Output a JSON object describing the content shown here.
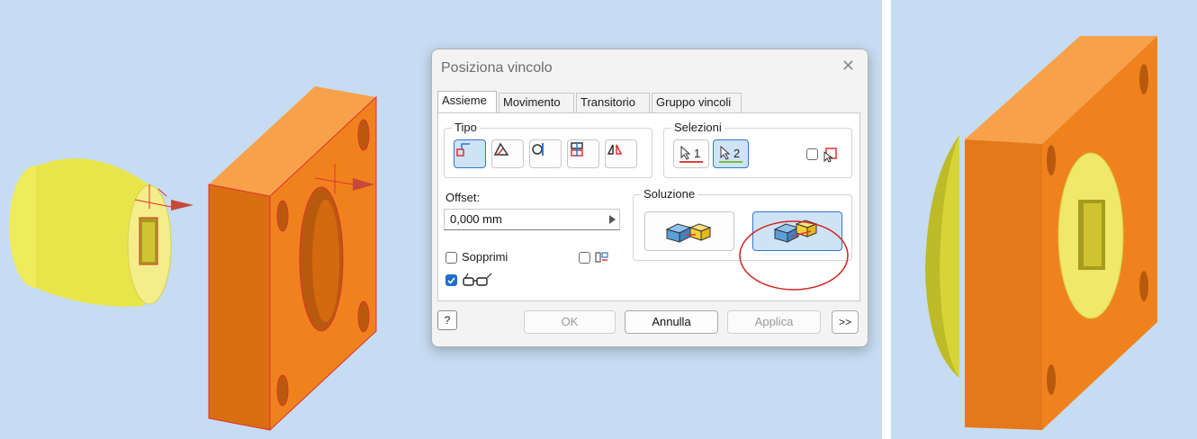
{
  "dialog": {
    "title": "Posiziona vincolo",
    "close_glyph": "✕",
    "tabs": [
      {
        "label": "Assieme",
        "active": true
      },
      {
        "label": "Movimento",
        "active": false
      },
      {
        "label": "Transitorio",
        "active": false
      },
      {
        "label": "Gruppo vincoli",
        "active": false
      }
    ],
    "tipo": {
      "label": "Tipo",
      "buttons": [
        {
          "icon": "mate-constraint-icon",
          "selected": true
        },
        {
          "icon": "angle-constraint-icon",
          "selected": false
        },
        {
          "icon": "tangent-constraint-icon",
          "selected": false
        },
        {
          "icon": "insert-constraint-icon",
          "selected": false
        },
        {
          "icon": "symmetry-constraint-icon",
          "selected": false
        }
      ]
    },
    "selezioni": {
      "label": "Selezioni",
      "buttons": [
        {
          "number": "1",
          "icon": "select-arrow-icon",
          "underline_color": "#e04040",
          "selected": false
        },
        {
          "number": "2",
          "icon": "select-arrow-icon",
          "underline_color": "#7bbd3a",
          "selected": true
        }
      ],
      "first_occurrence_checked": false,
      "first_occurrence_icon": "pick-part-first-icon"
    },
    "offset": {
      "label": "Offset:",
      "value": "0,000 mm"
    },
    "soluzione": {
      "label": "Soluzione",
      "options": [
        {
          "icon": "mate-solution-icon",
          "selected": false
        },
        {
          "icon": "flush-solution-icon",
          "selected": true
        }
      ]
    },
    "sopprimi": {
      "label": "Sopprimi",
      "checked": false
    },
    "predict_offset": {
      "checked": false,
      "icon": "predict-offset-icon"
    },
    "preview": {
      "checked": true,
      "icon": "preview-glasses-icon"
    },
    "buttons": {
      "ok": "OK",
      "cancel": "Annulla",
      "apply": "Applica",
      "more": ">>",
      "help": "?"
    }
  },
  "colors": {
    "viewport_bg": "#c6dcf2",
    "part_orange": "#f0821e",
    "part_orange_dark": "#c05f10",
    "part_yellow": "#f0ef5a",
    "highlight_red": "#e03030",
    "accent_blue": "#2f78c8"
  }
}
